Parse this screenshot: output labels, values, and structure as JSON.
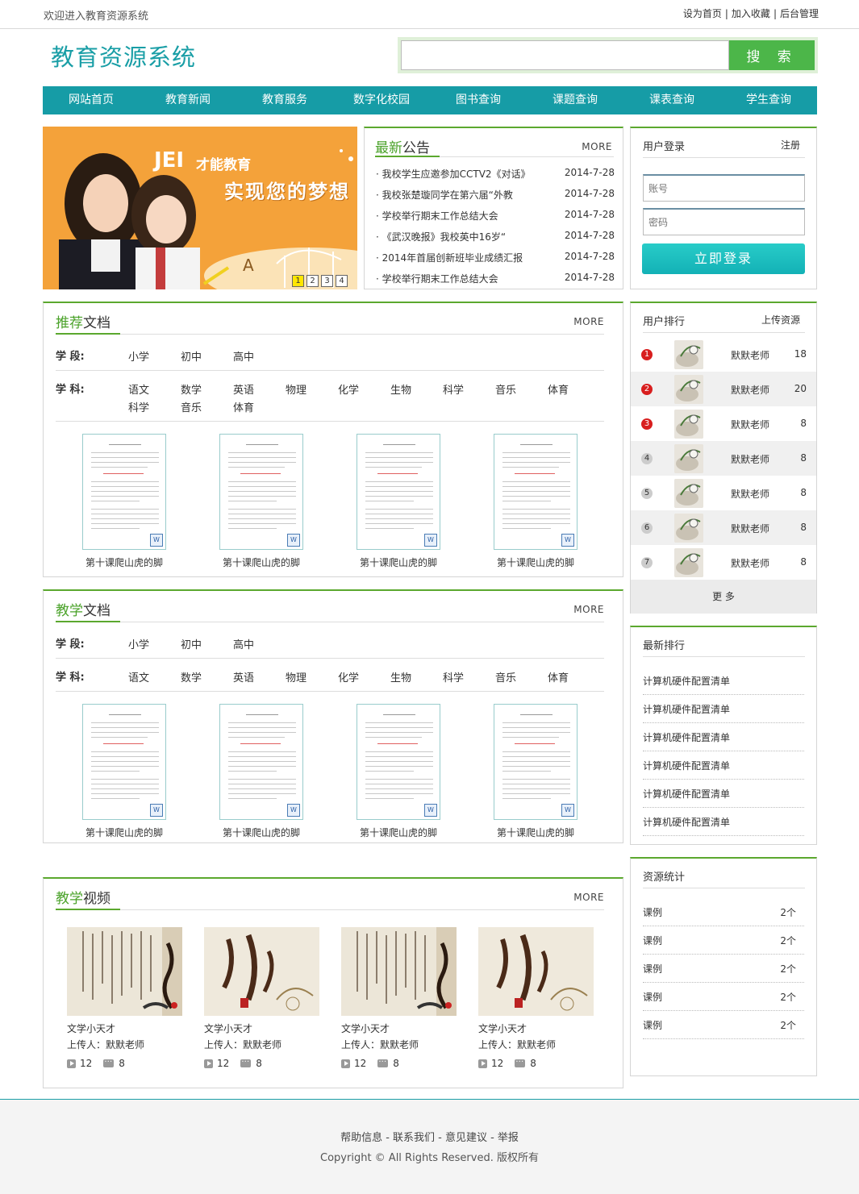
{
  "topbar": {
    "welcome": "欢迎进入教育资源系统",
    "links": [
      "设为首页",
      "加入收藏",
      "后台管理"
    ],
    "separator": "|"
  },
  "header": {
    "title": "教育资源系统",
    "search_placeholder": "",
    "search_button": "搜 索"
  },
  "nav": [
    "网站首页",
    "教育新闻",
    "教育服务",
    "数字化校园",
    "图书查询",
    "课题查询",
    "课表查询",
    "学生查询"
  ],
  "banner": {
    "brand": "JEI",
    "brand_sub": "才能教育",
    "slogan": "实现您的梦想",
    "pages": [
      "1",
      "2",
      "3",
      "4"
    ],
    "active_page": "1"
  },
  "notice": {
    "title_hl": "最新",
    "title_rest": "公告",
    "more": "MORE",
    "items": [
      {
        "text": "· 我校学生应邀参加CCTV2《对话》",
        "date": "2014-7-28"
      },
      {
        "text": "· 我校张楚璇同学在第六届“外教",
        "date": "2014-7-28"
      },
      {
        "text": "· 学校举行期末工作总结大会",
        "date": "2014-7-28"
      },
      {
        "text": "· 《武汉晚报》我校英中16岁“",
        "date": "2014-7-28"
      },
      {
        "text": "· 2014年首届创新班毕业成绩汇报",
        "date": "2014-7-28"
      },
      {
        "text": "· 学校举行期末工作总结大会",
        "date": "2014-7-28"
      }
    ]
  },
  "login": {
    "title": "用户登录",
    "register": "注册",
    "account_placeholder": "账号",
    "password_placeholder": "密码",
    "button": "立即登录"
  },
  "recommend": {
    "title_hl": "推荐",
    "title_rest": "文档",
    "more": "MORE",
    "stage_label": "学 段:",
    "stages": [
      "小学",
      "初中",
      "高中"
    ],
    "subject_label": "学 科:",
    "subjects_row1": [
      "语文",
      "数学",
      "英语",
      "物理",
      "化学",
      "生物",
      "科学",
      "音乐",
      "体育"
    ],
    "subjects_row2": [
      "科学",
      "音乐",
      "体育"
    ],
    "docs": [
      "第十课爬山虎的脚",
      "第十课爬山虎的脚",
      "第十课爬山虎的脚",
      "第十课爬山虎的脚"
    ]
  },
  "teaching": {
    "title_hl": "教学",
    "title_rest": "文档",
    "more": "MORE",
    "stage_label": "学 段:",
    "stages": [
      "小学",
      "初中",
      "高中"
    ],
    "subject_label": "学 科:",
    "subjects_row1": [
      "语文",
      "数学",
      "英语",
      "物理",
      "化学",
      "生物",
      "科学",
      "音乐",
      "体育"
    ],
    "docs": [
      "第十课爬山虎的脚",
      "第十课爬山虎的脚",
      "第十课爬山虎的脚",
      "第十课爬山虎的脚"
    ]
  },
  "video": {
    "title_hl": "教学",
    "title_rest": "视频",
    "more": "MORE",
    "items": [
      {
        "title": "文学小天才",
        "uploader": "上传人：默默老师",
        "plays": "12",
        "comments": "8"
      },
      {
        "title": "文学小天才",
        "uploader": "上传人：默默老师",
        "plays": "12",
        "comments": "8"
      },
      {
        "title": "文学小天才",
        "uploader": "上传人：默默老师",
        "plays": "12",
        "comments": "8"
      },
      {
        "title": "文学小天才",
        "uploader": "上传人：默默老师",
        "plays": "12",
        "comments": "8"
      }
    ]
  },
  "ranking": {
    "title": "用户排行",
    "subtitle": "上传资源",
    "rows": [
      {
        "rank": "1",
        "name": "默默老师",
        "count": "18"
      },
      {
        "rank": "2",
        "name": "默默老师",
        "count": "20"
      },
      {
        "rank": "3",
        "name": "默默老师",
        "count": "8"
      },
      {
        "rank": "4",
        "name": "默默老师",
        "count": "8"
      },
      {
        "rank": "5",
        "name": "默默老师",
        "count": "8"
      },
      {
        "rank": "6",
        "name": "默默老师",
        "count": "8"
      },
      {
        "rank": "7",
        "name": "默默老师",
        "count": "8"
      }
    ],
    "more": "更 多"
  },
  "latest": {
    "title": "最新排行",
    "items": [
      "计算机硬件配置清单",
      "计算机硬件配置清单",
      "计算机硬件配置清单",
      "计算机硬件配置清单",
      "计算机硬件配置清单",
      "计算机硬件配置清单"
    ]
  },
  "stats": {
    "title": "资源统计",
    "rows": [
      {
        "label": "课例",
        "value": "2个"
      },
      {
        "label": "课例",
        "value": "2个"
      },
      {
        "label": "课例",
        "value": "2个"
      },
      {
        "label": "课例",
        "value": "2个"
      },
      {
        "label": "课例",
        "value": "2个"
      }
    ]
  },
  "footer": {
    "links": "帮助信息 - 联系我们 - 意见建议 - 举报",
    "copyright": "Copyright © All Rights Reserved. 版权所有"
  },
  "colors": {
    "accent": "#169ca6",
    "green": "#4cb649",
    "panel_green": "#5ba82e",
    "banner": "#f4a23a"
  }
}
